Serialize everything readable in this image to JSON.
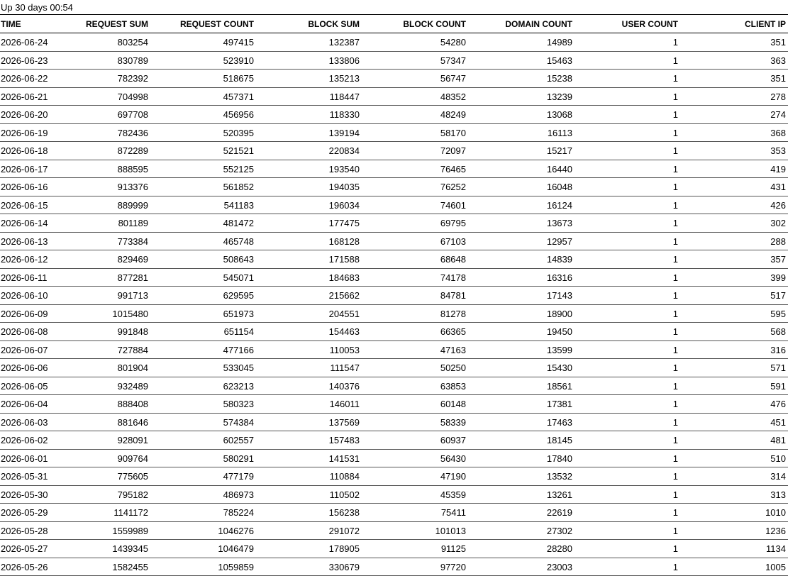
{
  "uptime": "Up 30 days 00:54",
  "columns": [
    "TIME",
    "REQUEST SUM",
    "REQUEST COUNT",
    "BLOCK SUM",
    "BLOCK COUNT",
    "DOMAIN COUNT",
    "USER COUNT",
    "CLIENT IP"
  ],
  "rows": [
    [
      "2026-06-24",
      "803254",
      "497415",
      "132387",
      "54280",
      "14989",
      "1",
      "351"
    ],
    [
      "2026-06-23",
      "830789",
      "523910",
      "133806",
      "57347",
      "15463",
      "1",
      "363"
    ],
    [
      "2026-06-22",
      "782392",
      "518675",
      "135213",
      "56747",
      "15238",
      "1",
      "351"
    ],
    [
      "2026-06-21",
      "704998",
      "457371",
      "118447",
      "48352",
      "13239",
      "1",
      "278"
    ],
    [
      "2026-06-20",
      "697708",
      "456956",
      "118330",
      "48249",
      "13068",
      "1",
      "274"
    ],
    [
      "2026-06-19",
      "782436",
      "520395",
      "139194",
      "58170",
      "16113",
      "1",
      "368"
    ],
    [
      "2026-06-18",
      "872289",
      "521521",
      "220834",
      "72097",
      "15217",
      "1",
      "353"
    ],
    [
      "2026-06-17",
      "888595",
      "552125",
      "193540",
      "76465",
      "16440",
      "1",
      "419"
    ],
    [
      "2026-06-16",
      "913376",
      "561852",
      "194035",
      "76252",
      "16048",
      "1",
      "431"
    ],
    [
      "2026-06-15",
      "889999",
      "541183",
      "196034",
      "74601",
      "16124",
      "1",
      "426"
    ],
    [
      "2026-06-14",
      "801189",
      "481472",
      "177475",
      "69795",
      "13673",
      "1",
      "302"
    ],
    [
      "2026-06-13",
      "773384",
      "465748",
      "168128",
      "67103",
      "12957",
      "1",
      "288"
    ],
    [
      "2026-06-12",
      "829469",
      "508643",
      "171588",
      "68648",
      "14839",
      "1",
      "357"
    ],
    [
      "2026-06-11",
      "877281",
      "545071",
      "184683",
      "74178",
      "16316",
      "1",
      "399"
    ],
    [
      "2026-06-10",
      "991713",
      "629595",
      "215662",
      "84781",
      "17143",
      "1",
      "517"
    ],
    [
      "2026-06-09",
      "1015480",
      "651973",
      "204551",
      "81278",
      "18900",
      "1",
      "595"
    ],
    [
      "2026-06-08",
      "991848",
      "651154",
      "154463",
      "66365",
      "19450",
      "1",
      "568"
    ],
    [
      "2026-06-07",
      "727884",
      "477166",
      "110053",
      "47163",
      "13599",
      "1",
      "316"
    ],
    [
      "2026-06-06",
      "801904",
      "533045",
      "111547",
      "50250",
      "15430",
      "1",
      "571"
    ],
    [
      "2026-06-05",
      "932489",
      "623213",
      "140376",
      "63853",
      "18561",
      "1",
      "591"
    ],
    [
      "2026-06-04",
      "888408",
      "580323",
      "146011",
      "60148",
      "17381",
      "1",
      "476"
    ],
    [
      "2026-06-03",
      "881646",
      "574384",
      "137569",
      "58339",
      "17463",
      "1",
      "451"
    ],
    [
      "2026-06-02",
      "928091",
      "602557",
      "157483",
      "60937",
      "18145",
      "1",
      "481"
    ],
    [
      "2026-06-01",
      "909764",
      "580291",
      "141531",
      "56430",
      "17840",
      "1",
      "510"
    ],
    [
      "2026-05-31",
      "775605",
      "477179",
      "110884",
      "47190",
      "13532",
      "1",
      "314"
    ],
    [
      "2026-05-30",
      "795182",
      "486973",
      "110502",
      "45359",
      "13261",
      "1",
      "313"
    ],
    [
      "2026-05-29",
      "1141172",
      "785224",
      "156238",
      "75411",
      "22619",
      "1",
      "1010"
    ],
    [
      "2026-05-28",
      "1559989",
      "1046276",
      "291072",
      "101013",
      "27302",
      "1",
      "1236"
    ],
    [
      "2026-05-27",
      "1439345",
      "1046479",
      "178905",
      "91125",
      "28280",
      "1",
      "1134"
    ],
    [
      "2026-05-26",
      "1582455",
      "1059859",
      "330679",
      "97720",
      "23003",
      "1",
      "1005"
    ]
  ]
}
